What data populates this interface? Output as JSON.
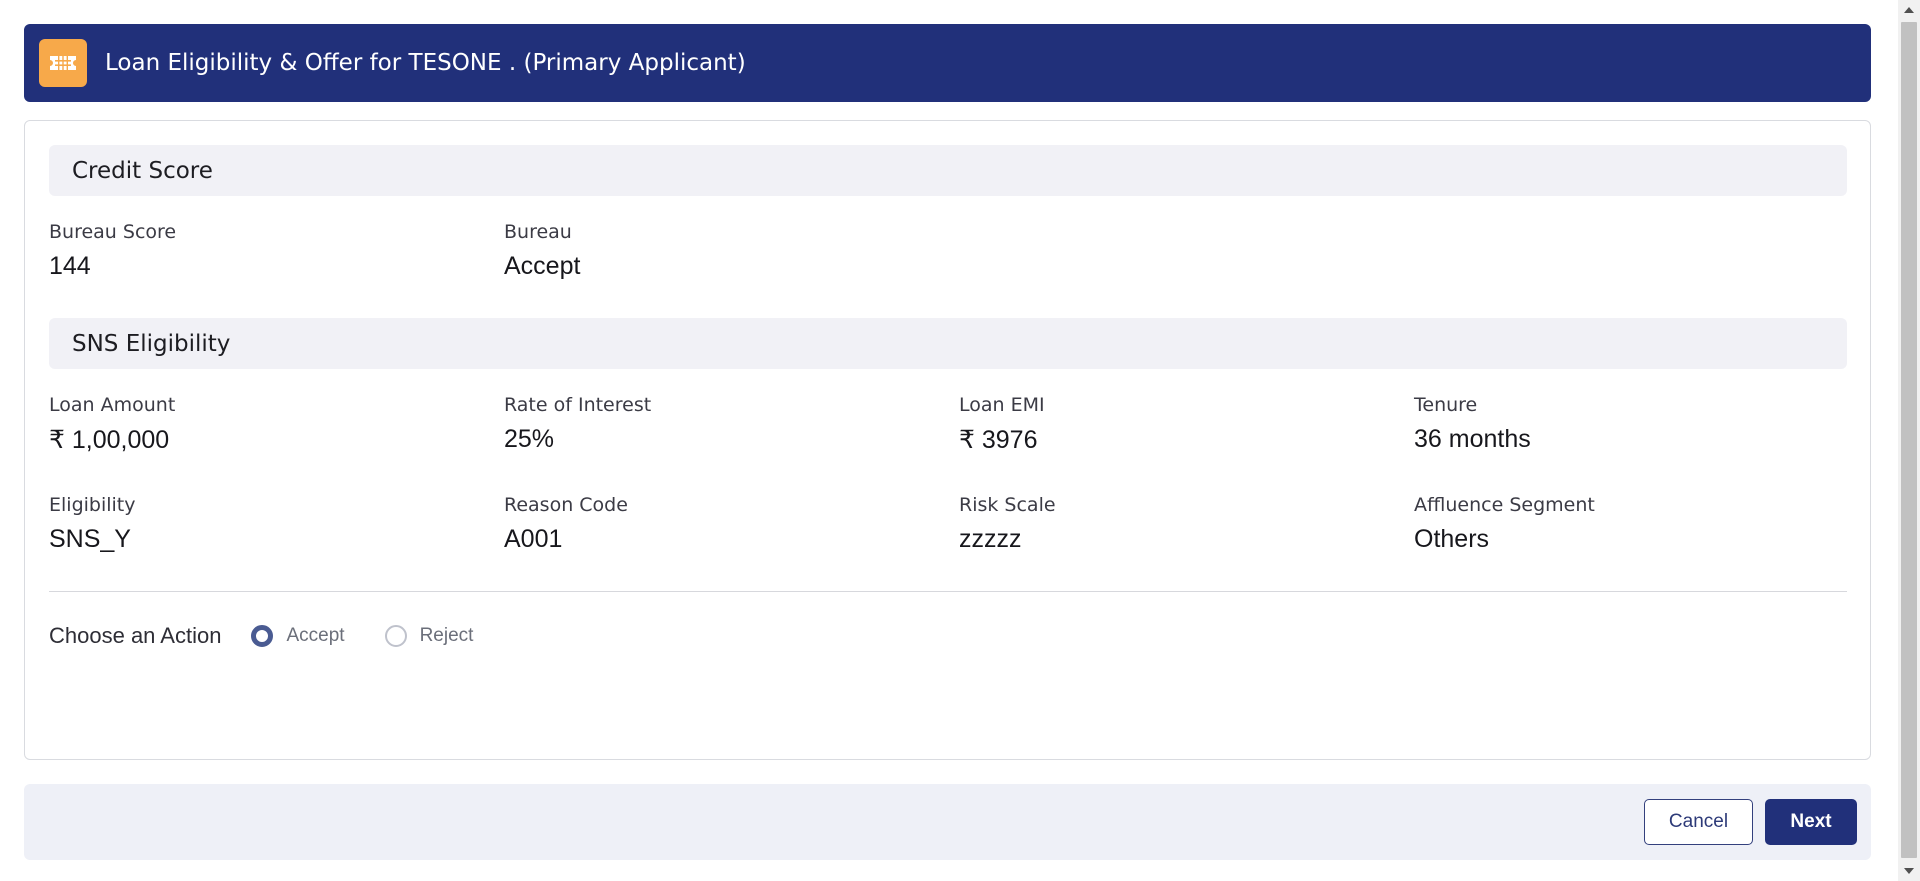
{
  "header": {
    "icon": "ticket-icon",
    "title": "Loan Eligibility & Offer for TESONE . (Primary Applicant)",
    "accent_color": "#21307a",
    "icon_bg": "#f7a94a"
  },
  "credit_score": {
    "title": "Credit Score",
    "fields": [
      {
        "label": "Bureau Score",
        "value": "144"
      },
      {
        "label": "Bureau",
        "value": "Accept"
      }
    ]
  },
  "sns_eligibility": {
    "title": "SNS Eligibility",
    "fields": [
      {
        "label": "Loan Amount",
        "value": "₹ 1,00,000"
      },
      {
        "label": "Rate of Interest",
        "value": "25%"
      },
      {
        "label": "Loan EMI",
        "value": "₹ 3976"
      },
      {
        "label": "Tenure",
        "value": "36 months"
      },
      {
        "label": "Eligibility",
        "value": "SNS_Y"
      },
      {
        "label": "Reason Code",
        "value": "A001"
      },
      {
        "label": "Risk Scale",
        "value": "zzzzz"
      },
      {
        "label": "Affluence Segment",
        "value": "Others"
      }
    ]
  },
  "action": {
    "label": "Choose an Action",
    "options": [
      {
        "label": "Accept",
        "selected": true
      },
      {
        "label": "Reject",
        "selected": false
      }
    ]
  },
  "footer": {
    "cancel_label": "Cancel",
    "next_label": "Next"
  }
}
